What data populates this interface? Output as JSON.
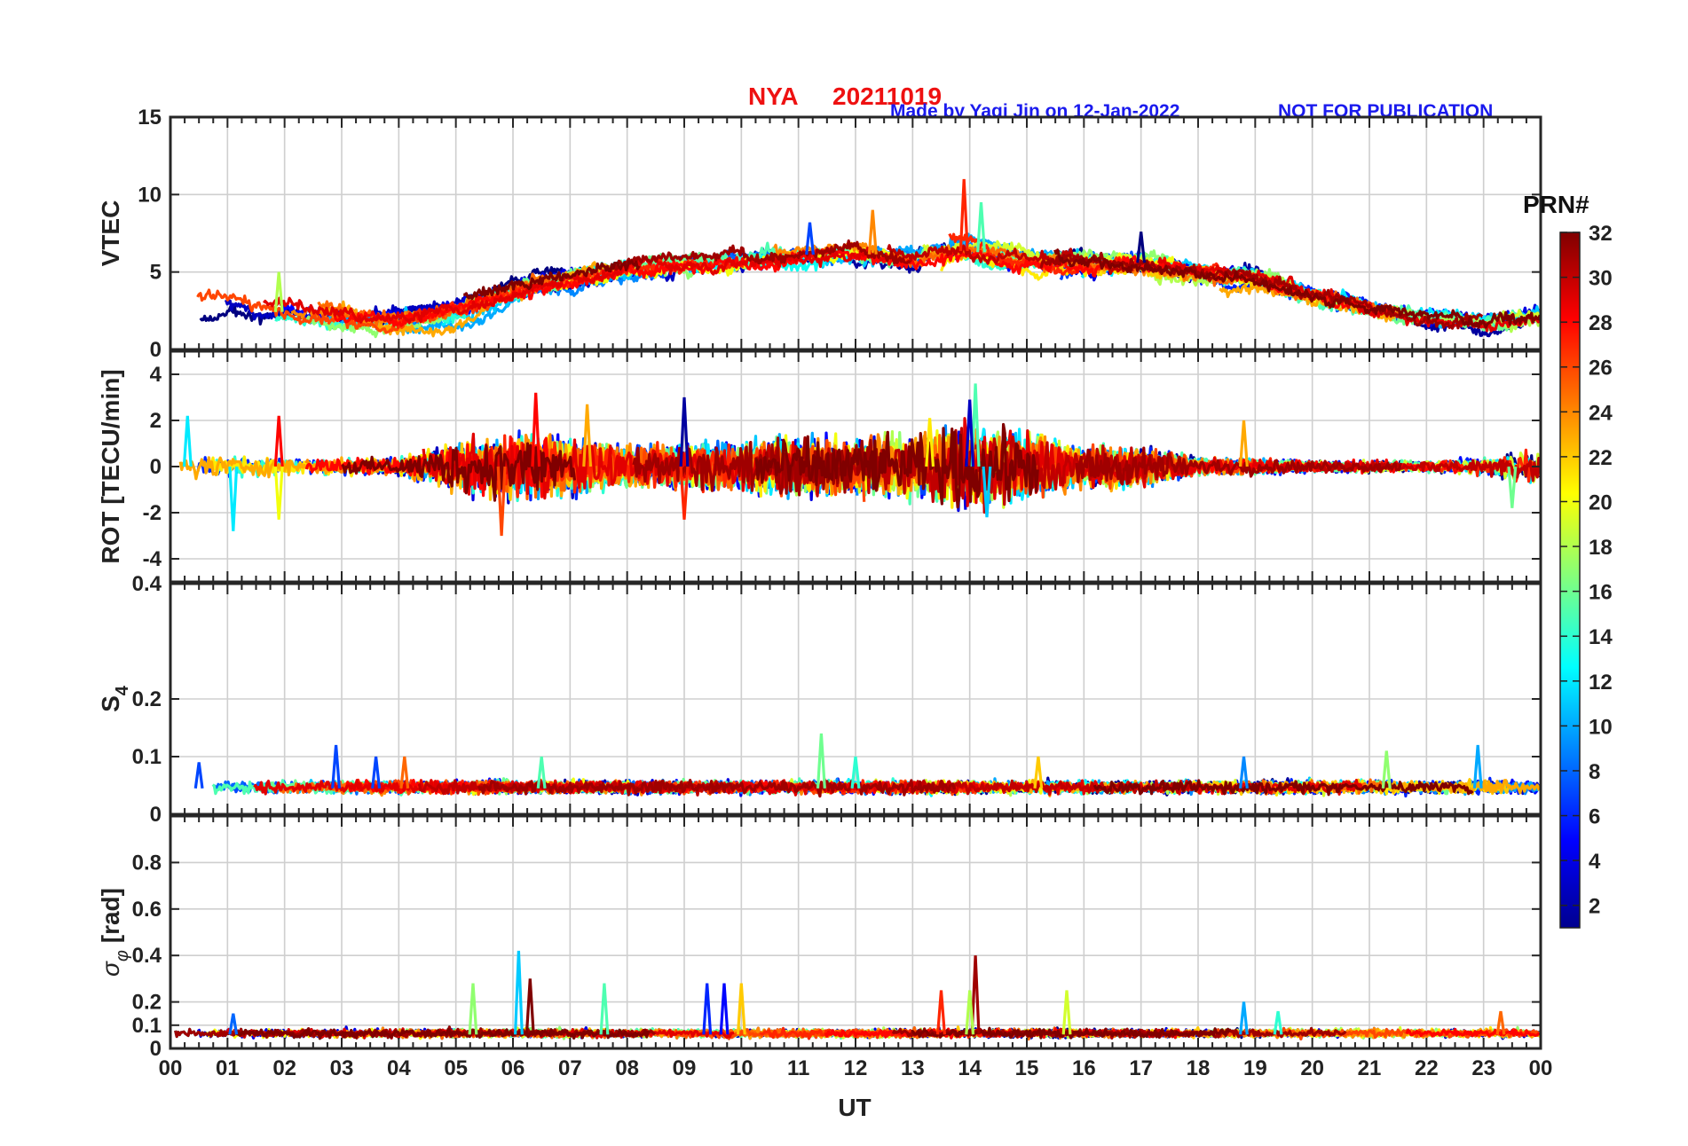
{
  "title": {
    "station": "NYA",
    "date": "20211019"
  },
  "credit": {
    "made_by": "Made by Yaqi Jin on 12-Jan-2022",
    "notice": "NOT FOR PUBLICATION"
  },
  "colorbar": {
    "title": "PRN#",
    "min": 1,
    "max": 32,
    "tick_labels": [
      "2",
      "4",
      "6",
      "8",
      "10",
      "12",
      "14",
      "16",
      "18",
      "20",
      "22",
      "24",
      "26",
      "28",
      "30",
      "32"
    ],
    "tick_values": [
      2,
      4,
      6,
      8,
      10,
      12,
      14,
      16,
      18,
      20,
      22,
      24,
      26,
      28,
      30,
      32
    ],
    "colormap": "jet"
  },
  "chart_data": {
    "type": "line",
    "x_axis": {
      "label": "UT",
      "range": [
        0,
        24
      ],
      "tick_labels": [
        "00",
        "01",
        "02",
        "03",
        "04",
        "05",
        "06",
        "07",
        "08",
        "09",
        "10",
        "11",
        "12",
        "13",
        "14",
        "15",
        "16",
        "17",
        "18",
        "19",
        "20",
        "21",
        "22",
        "23",
        "00"
      ],
      "tick_values": [
        0,
        1,
        2,
        3,
        4,
        5,
        6,
        7,
        8,
        9,
        10,
        11,
        12,
        13,
        14,
        15,
        16,
        17,
        18,
        19,
        20,
        21,
        22,
        23,
        24
      ]
    },
    "grid": true,
    "series_key": "colored by GPS PRN (1-32)",
    "panels": [
      {
        "id": "vtec",
        "ylabel": "VTEC",
        "ylim": [
          0,
          15
        ],
        "ytick_labels": [
          "0",
          "5",
          "10",
          "15"
        ],
        "ytick_values": [
          0,
          5,
          10,
          15
        ],
        "envelope_x": [
          0,
          1,
          2,
          3,
          4,
          5,
          6,
          7,
          8,
          9,
          10,
          11,
          12,
          13,
          14,
          15,
          16,
          17,
          18,
          19,
          20,
          21,
          22,
          23,
          24
        ],
        "envelope_mean": [
          2.8,
          2.6,
          2.4,
          2.0,
          1.8,
          2.6,
          3.8,
          4.6,
          5.2,
          5.5,
          5.8,
          6.1,
          6.2,
          6.0,
          6.4,
          5.8,
          5.7,
          5.6,
          5.0,
          4.6,
          3.6,
          2.6,
          2.1,
          1.8,
          2.2
        ],
        "envelope_peaks": [
          [
            11.2,
            8.2
          ],
          [
            12.3,
            9.0
          ],
          [
            13.9,
            11.0
          ],
          [
            14.2,
            9.5
          ],
          [
            1.9,
            5.0
          ],
          [
            17.0,
            7.6
          ]
        ]
      },
      {
        "id": "rot",
        "ylabel": "ROT [TECU/min]",
        "ylim": [
          -5,
          5
        ],
        "ytick_labels": [
          "-4",
          "-2",
          "0",
          "2",
          "4"
        ],
        "ytick_values": [
          -4,
          -2,
          0,
          2,
          4
        ],
        "envelope_amp": [
          0.5,
          0.4,
          0.3,
          0.3,
          0.3,
          0.9,
          1.2,
          1.0,
          0.7,
          0.8,
          0.9,
          1.0,
          1.0,
          1.1,
          1.6,
          1.2,
          0.8,
          0.7,
          0.3,
          0.3,
          0.2,
          0.2,
          0.2,
          0.3,
          0.7
        ],
        "spikes": [
          [
            0.3,
            2.2
          ],
          [
            1.1,
            -2.8
          ],
          [
            1.9,
            2.2
          ],
          [
            1.9,
            -2.3
          ],
          [
            5.8,
            -3.0
          ],
          [
            6.4,
            3.2
          ],
          [
            7.3,
            2.7
          ],
          [
            9.0,
            3.0
          ],
          [
            9.0,
            -2.3
          ],
          [
            13.3,
            2.1
          ],
          [
            14.1,
            3.6
          ],
          [
            14.0,
            2.9
          ],
          [
            14.3,
            -2.2
          ],
          [
            23.5,
            -1.8
          ],
          [
            18.8,
            2.0
          ]
        ]
      },
      {
        "id": "s4",
        "ylabel": "S4",
        "ylim": [
          0,
          0.4
        ],
        "ytick_labels": [
          "0",
          "0.1",
          "0.2",
          "0.4"
        ],
        "ytick_values": [
          0,
          0.1,
          0.2,
          0.4
        ],
        "baseline": 0.045,
        "spikes": [
          [
            0.5,
            0.09
          ],
          [
            2.9,
            0.12
          ],
          [
            3.6,
            0.1
          ],
          [
            4.1,
            0.1
          ],
          [
            6.5,
            0.1
          ],
          [
            11.4,
            0.14
          ],
          [
            12.0,
            0.1
          ],
          [
            15.2,
            0.1
          ],
          [
            18.8,
            0.1
          ],
          [
            21.3,
            0.11
          ],
          [
            22.9,
            0.12
          ]
        ]
      },
      {
        "id": "sigma_phi",
        "ylabel": "σφ [rad]",
        "ylim": [
          0,
          1.0
        ],
        "ytick_labels": [
          "0",
          "0.1",
          "0.2",
          "0.4",
          "0.6",
          "0.8"
        ],
        "ytick_values": [
          0,
          0.1,
          0.2,
          0.4,
          0.6,
          0.8
        ],
        "baseline": 0.06,
        "spikes": [
          [
            1.1,
            0.15
          ],
          [
            5.3,
            0.28
          ],
          [
            6.1,
            0.42
          ],
          [
            6.3,
            0.3
          ],
          [
            7.6,
            0.28
          ],
          [
            9.4,
            0.28
          ],
          [
            9.7,
            0.28
          ],
          [
            10.0,
            0.28
          ],
          [
            13.5,
            0.25
          ],
          [
            14.1,
            0.4
          ],
          [
            14.0,
            0.25
          ],
          [
            15.7,
            0.25
          ],
          [
            18.8,
            0.2
          ],
          [
            19.4,
            0.16
          ],
          [
            23.3,
            0.16
          ]
        ]
      }
    ]
  }
}
